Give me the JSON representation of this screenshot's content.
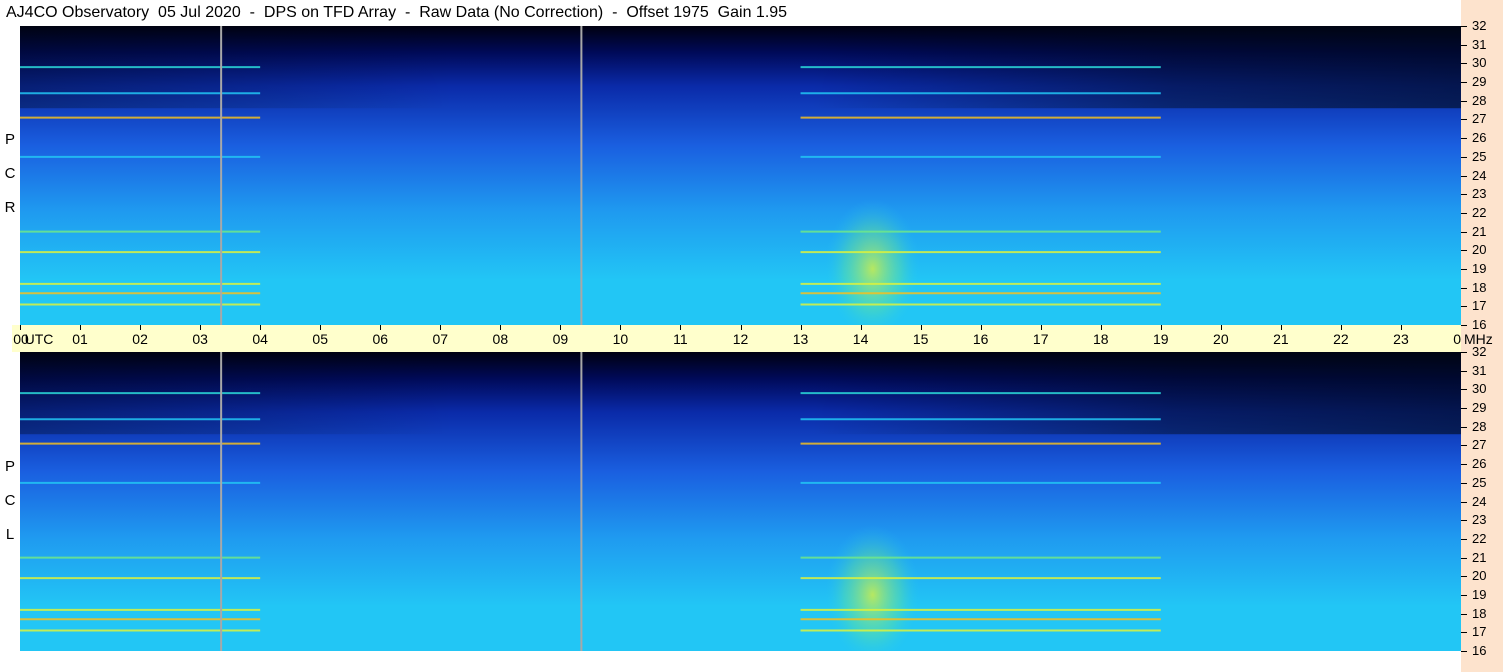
{
  "title": "AJ4CO Observatory  05 Jul 2020  -  DPS on TFD Array  -  Raw Data (No Correction)  -  Offset 1975  Gain 1.95",
  "colors": {
    "background": "#ffffff",
    "time_axis_bg": "#ffffcc",
    "freq_bar_bg": "#fde3cd",
    "colormap": [
      "#000010",
      "#000a5a",
      "#0a2aa8",
      "#1a5fe0",
      "#1f9af0",
      "#22c6f5",
      "#2bd8d8",
      "#6ee88a",
      "#dcf23c",
      "#f5c020",
      "#e84020",
      "#c01060"
    ]
  },
  "polarizations": {
    "rcp": [
      "R",
      "C",
      "P"
    ],
    "lcp": [
      "L",
      "C",
      "P"
    ]
  },
  "chart_data": {
    "type": "heatmap",
    "title": "AJ4CO Observatory  05 Jul 2020  -  DPS on TFD Array  -  Raw Data (No Correction)  -  Offset 1975  Gain 1.95",
    "x_unit": "UTC",
    "y_unit": "MHz",
    "x_ticks": [
      "00",
      "01",
      "02",
      "03",
      "04",
      "05",
      "06",
      "07",
      "08",
      "09",
      "10",
      "11",
      "12",
      "13",
      "14",
      "15",
      "16",
      "17",
      "18",
      "19",
      "20",
      "21",
      "22",
      "23",
      "00"
    ],
    "xlim": [
      0,
      24
    ],
    "y_ticks": [
      32,
      31,
      30,
      29,
      28,
      27,
      26,
      25,
      24,
      23,
      22,
      21,
      20,
      19,
      18,
      17,
      16
    ],
    "ylim": [
      16,
      32
    ],
    "panels": [
      "RCP",
      "LCP"
    ],
    "gaps_utc": [
      3.35,
      9.35
    ],
    "bright_bands_mhz": [
      29.8,
      28.4,
      27.1,
      25.0,
      21.0,
      19.9,
      18.2,
      17.7,
      17.1
    ],
    "enhancement_utc": [
      13.4,
      15.0
    ]
  }
}
